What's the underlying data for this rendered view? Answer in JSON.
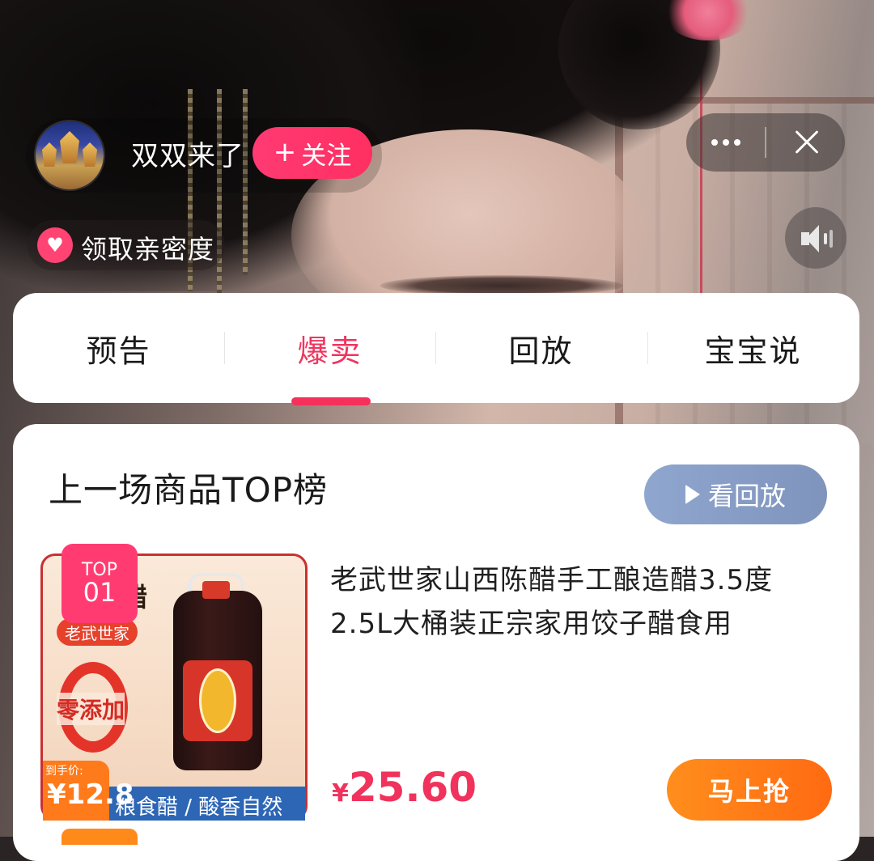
{
  "stream": {
    "host_name": "双双来了",
    "follow_label": "关注",
    "follow_icon": "plus-icon",
    "more_icon": "more-dots-icon",
    "close_icon": "close-icon",
    "intimacy_label": "领取亲密度",
    "intimacy_icon": "heart-icon",
    "speaker_icon": "speaker-icon"
  },
  "tabs": [
    {
      "label": "预告",
      "active": false
    },
    {
      "label": "爆卖",
      "active": true
    },
    {
      "label": "回放",
      "active": false
    },
    {
      "label": "宝宝说",
      "active": false
    }
  ],
  "panel": {
    "title": "上一场商品TOP榜",
    "replay_label": "看回放",
    "replay_icon": "play-icon"
  },
  "product": {
    "rank_top": "TOP",
    "rank_num": "01",
    "title": "老武世家山西陈醋手工酿造醋3.5度2.5L大桶装正宗家用饺子醋食用",
    "currency": "¥",
    "price": "25.60",
    "buy_label": "马上抢",
    "image_text": {
      "title": "东醋",
      "brand": "老武世家",
      "zero_add": "零添加",
      "price_label": "到手价:",
      "price": "¥12.8",
      "footer": "粮食醋 / 酸香自然"
    }
  },
  "colors": {
    "accent_pink": "#f0355f",
    "follow_pink": "#ff3a74",
    "buy_orange": "#ff7a16",
    "replay_blue": "#8fa6cf"
  }
}
